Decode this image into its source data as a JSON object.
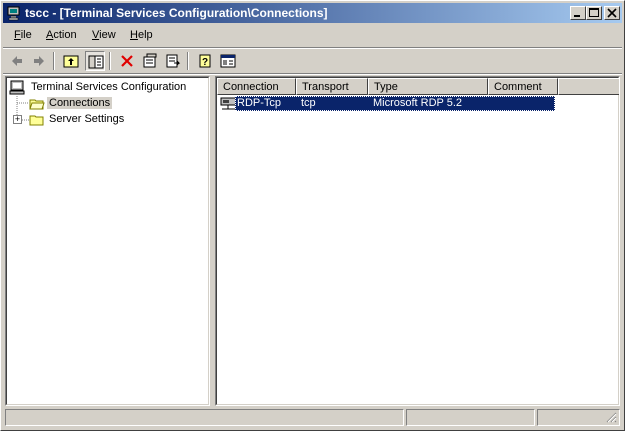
{
  "window": {
    "title": "tscc - [Terminal Services Configuration\\Connections]",
    "minimize_label": "_",
    "maximize_label": "□",
    "close_label": "×"
  },
  "menu": [
    {
      "label": "File",
      "accel": "F",
      "rest": "ile"
    },
    {
      "label": "Action",
      "accel": "A",
      "rest": "ction"
    },
    {
      "label": "View",
      "accel": "V",
      "rest": "iew"
    },
    {
      "label": "Help",
      "accel": "H",
      "rest": "elp"
    }
  ],
  "toolbar": {
    "icons": [
      "back-icon",
      "forward-icon",
      "up-folder-icon",
      "show-hide-tree-icon",
      "delete-icon",
      "properties-icon",
      "export-list-icon",
      "help-icon",
      "console-tree-icon"
    ]
  },
  "tree": {
    "root": "Terminal Services Configuration",
    "items": [
      {
        "label": "Connections",
        "selected": true
      },
      {
        "label": "Server Settings",
        "expandable": true,
        "expander": "+"
      }
    ]
  },
  "list": {
    "columns": [
      "Connection",
      "Transport",
      "Type",
      "Comment"
    ],
    "rows": [
      {
        "connection": "RDP-Tcp",
        "transport": "tcp",
        "type": "Microsoft RDP 5.2",
        "comment": ""
      }
    ]
  },
  "colors": {
    "titlebar_start": "#0a246a",
    "titlebar_end": "#a6caf0",
    "selection": "#0a246a",
    "face": "#d4d0c8"
  }
}
